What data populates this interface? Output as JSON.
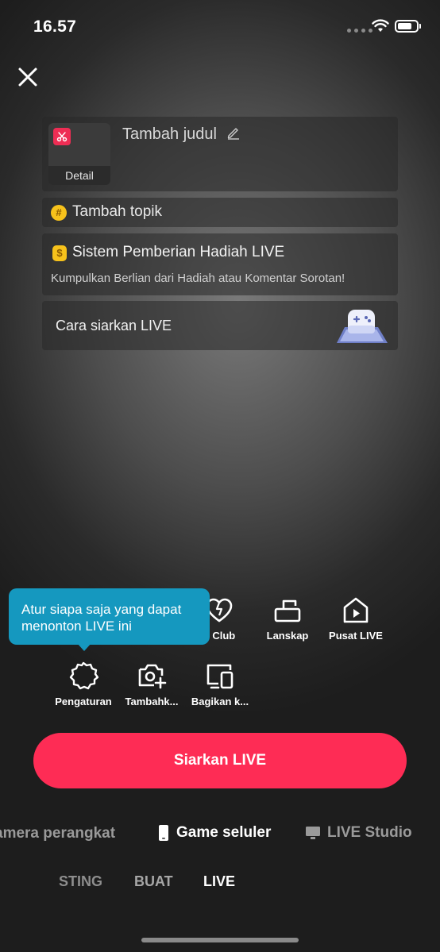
{
  "status_bar": {
    "time": "16.57"
  },
  "setup": {
    "cover_label": "Detail",
    "title_placeholder": "Tambah judul",
    "topic_label": "Tambah topik",
    "gift_title": "Sistem Pemberian Hadiah LIVE",
    "gift_subtitle": "Kumpulkan Berlian dari Hadiah atau Komentar Sorotan!",
    "howto_label": "Cara siarkan LIVE"
  },
  "tooltip": {
    "text": "Atur siapa saja yang dapat menonton LIVE ini"
  },
  "tools": {
    "fan_club": "n Club",
    "landscape": "Lanskap",
    "live_center": "Pusat LIVE",
    "settings": "Pengaturan",
    "add": "Tambahk...",
    "share": "Bagikan k..."
  },
  "go_live_label": "Siarkan LIVE",
  "modes": {
    "camera": "amera perangkat",
    "game": "Game seluler",
    "studio": "LIVE Studio"
  },
  "bottom_tabs": {
    "posting": "STING",
    "create": "BUAT",
    "live": "LIVE"
  },
  "colors": {
    "accent": "#fe2c55",
    "tooltip": "#1598bf",
    "badge_yellow": "#f7c21b"
  }
}
